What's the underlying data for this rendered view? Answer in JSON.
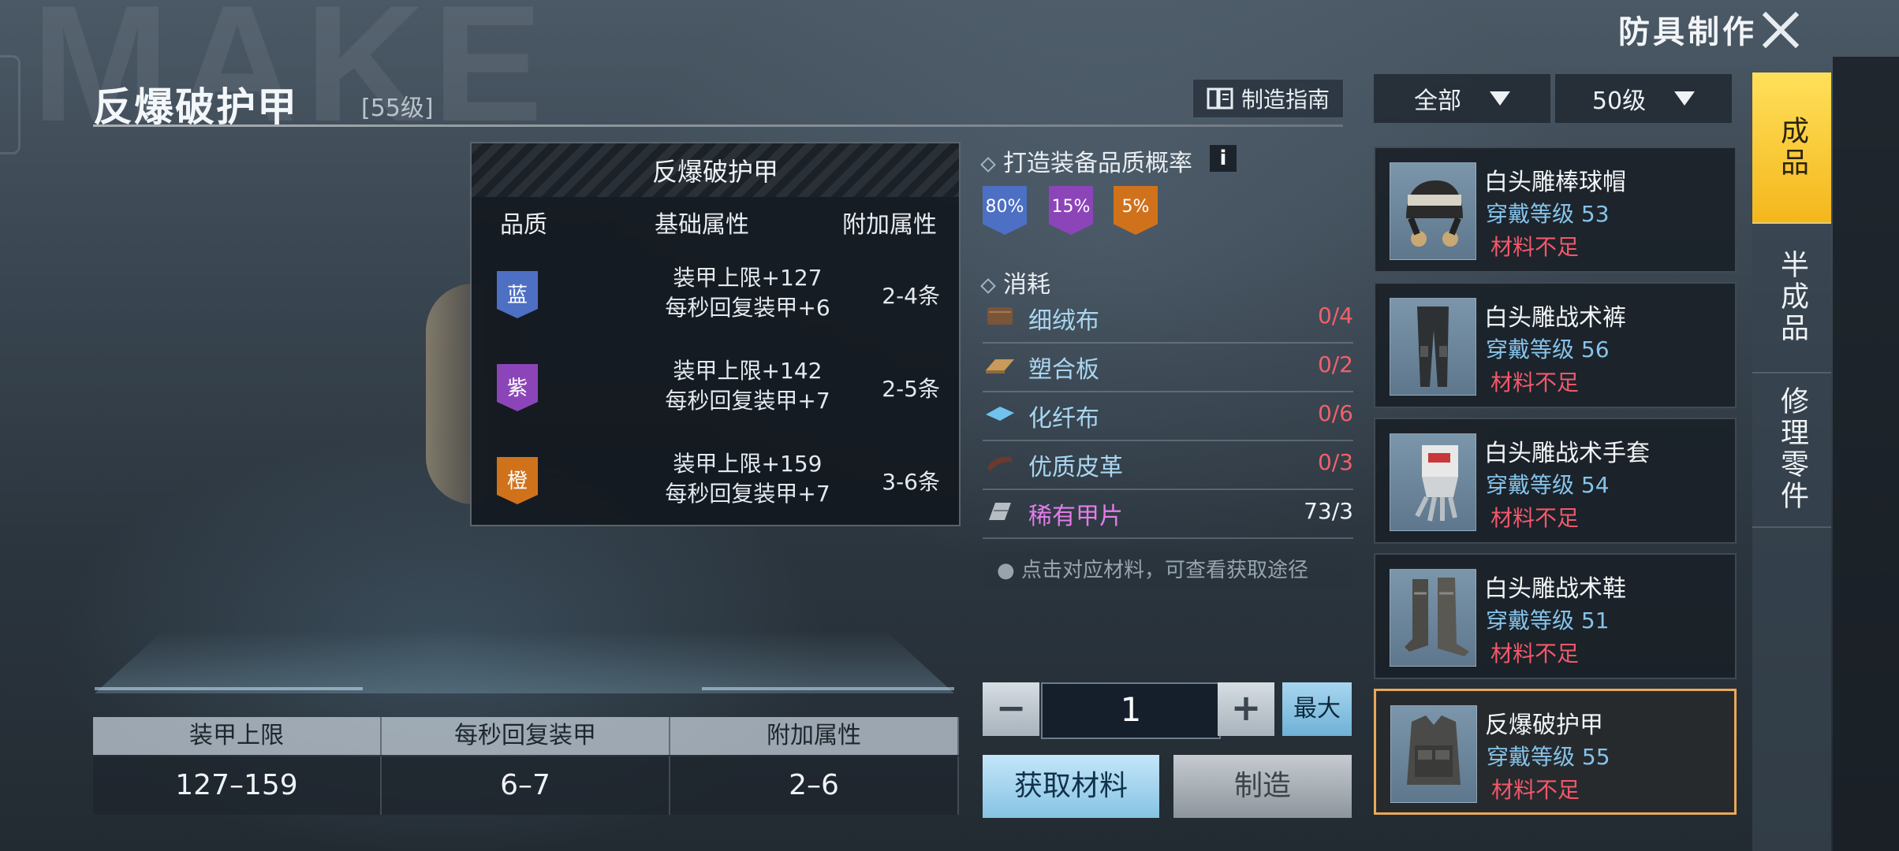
{
  "window": {
    "watermark": "MAKE",
    "title": "防具制作"
  },
  "item": {
    "name": "反爆破护甲",
    "level": "[55级]",
    "guide_label": "制造指南"
  },
  "quality_popup": {
    "title": "反爆破护甲",
    "col_quality": "品质",
    "col_base": "基础属性",
    "col_extra": "附加属性",
    "rows": [
      {
        "quality": "蓝",
        "color": "#4d6fc4",
        "base1": "装甲上限+127",
        "base2": "每秒回复装甲+6",
        "extra": "2-4条"
      },
      {
        "quality": "紫",
        "color": "#8c45b8",
        "base1": "装甲上限+142",
        "base2": "每秒回复装甲+7",
        "extra": "2-5条"
      },
      {
        "quality": "橙",
        "color": "#d0721c",
        "base1": "装甲上限+159",
        "base2": "每秒回复装甲+7",
        "extra": "3-6条"
      }
    ]
  },
  "stats": {
    "headers": [
      "装甲上限",
      "每秒回复装甲",
      "附加属性"
    ],
    "values": [
      "127–159",
      "6–7",
      "2–6"
    ]
  },
  "quality_rate": {
    "label": "打造装备品质概率",
    "info_icon": "i",
    "rates": [
      {
        "text": "80%",
        "color": "#4d6fc4"
      },
      {
        "text": "15%",
        "color": "#8c45b8"
      },
      {
        "text": "5%",
        "color": "#d0721c"
      }
    ]
  },
  "consume": {
    "label": "消耗",
    "materials": [
      {
        "name": "细绒布",
        "count": "0/4",
        "icon": "cloth-icon",
        "count_color": "#f0616a",
        "name_color": "#a9d6f0"
      },
      {
        "name": "塑合板",
        "count": "0/2",
        "icon": "board-icon",
        "count_color": "#f0616a",
        "name_color": "#a9d6f0"
      },
      {
        "name": "化纤布",
        "count": "0/6",
        "icon": "fiber-icon",
        "count_color": "#f0616a",
        "name_color": "#a9d6f0"
      },
      {
        "name": "优质皮革",
        "count": "0/3",
        "icon": "leather-icon",
        "count_color": "#f0616a",
        "name_color": "#a9d6f0"
      },
      {
        "name": "稀有甲片",
        "count": "73/3",
        "icon": "armor-plate-icon",
        "count_color": "#eef2f5",
        "name_color": "#e27de8"
      }
    ],
    "hint": "点击对应材料，可查看获取途径"
  },
  "quantity": {
    "minus": "−",
    "value": "1",
    "plus": "+",
    "max": "最大"
  },
  "actions": {
    "get_materials": "获取材料",
    "make": "制造"
  },
  "filters": {
    "category": "全部",
    "level": "50级"
  },
  "item_list": [
    {
      "name": "白头雕棒球帽",
      "level": "穿戴等级 53",
      "status": "材料不足",
      "selected": false
    },
    {
      "name": "白头雕战术裤",
      "level": "穿戴等级 56",
      "status": "材料不足",
      "selected": false
    },
    {
      "name": "白头雕战术手套",
      "level": "穿戴等级 54",
      "status": "材料不足",
      "selected": false
    },
    {
      "name": "白头雕战术鞋",
      "level": "穿戴等级 51",
      "status": "材料不足",
      "selected": false
    },
    {
      "name": "反爆破护甲",
      "level": "穿戴等级 55",
      "status": "材料不足",
      "selected": true
    }
  ],
  "side_tabs": [
    "成品",
    "半成品",
    "修理零件"
  ]
}
